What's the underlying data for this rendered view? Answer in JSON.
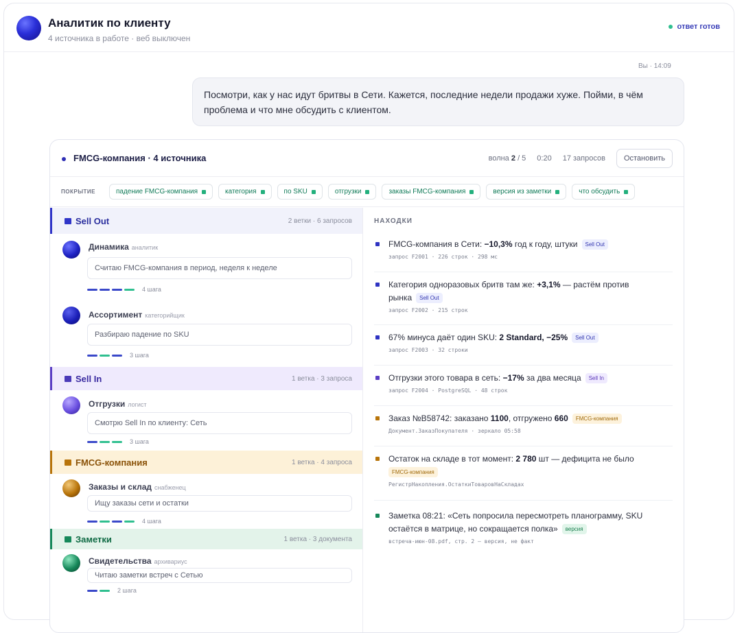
{
  "header": {
    "title": "Аналитик по клиенту",
    "subtitle": "4 источника в работе · веб выключен",
    "status": "ответ готов"
  },
  "message": {
    "meta": "Вы · 14:09",
    "text": "Посмотри, как у нас идут бритвы в Сети. Кажется, последние недели продажи хуже. Пойми, в чём проблема и что мне обсудить с клиентом."
  },
  "panel": {
    "title": "FMCG-компания · 4 источника",
    "wave_label": "волна",
    "wave_current": "2",
    "wave_total": "/ 5",
    "time": "0:20",
    "queries": "17 запросов",
    "stop_label": "Остановить"
  },
  "coverage": {
    "label": "ПОКРЫТИЕ",
    "chips": [
      "падение FMCG-компания",
      "категория",
      "по SKU",
      "отгрузки",
      "заказы FMCG-компания",
      "версия из заметки",
      "что обсудить"
    ]
  },
  "groups": [
    {
      "title": "Sell Out",
      "meta": "2 ветки · 6 запросов",
      "color": "#3035c8",
      "bg": "#f1f2fb"
    },
    {
      "title": "Sell In",
      "meta": "1 ветка · 3 запроса",
      "color": "#5b3fc4",
      "bg": "#efeafd"
    },
    {
      "title": "FMCG-компания",
      "meta": "1 ветка · 4 запроса",
      "color": "#b8740a",
      "bg": "#fdf1d8"
    },
    {
      "title": "Заметки",
      "meta": "1 ветка · 3 документа",
      "color": "#16885a",
      "bg": "#e3f3ea"
    }
  ],
  "agents": [
    {
      "name": "Динамика",
      "role": "аналитик",
      "task": "Считаю FMCG-компания в период, неделя к неделе",
      "steps": "4 шага"
    },
    {
      "name": "Ассортимент",
      "role": "категорийщик",
      "task": "Разбираю падение по SKU",
      "steps": "3 шага"
    },
    {
      "name": "Отгрузки",
      "role": "логист",
      "task": "Смотрю Sell In по клиенту: Сеть",
      "steps": "3 шага"
    },
    {
      "name": "Заказы и склад",
      "role": "снабженец",
      "task": "Ищу заказы сети и остатки",
      "steps": "4 шага"
    },
    {
      "name": "Свидетельства",
      "role": "архивариус",
      "task": "Читаю заметки встреч с Сетью",
      "steps": "2 шага"
    }
  ],
  "findings_header": "НАХОДКИ",
  "findings": [
    {
      "pre": "FMCG-компания в Сети: ",
      "bold": "−10,3%",
      "post": " год к году, штуки",
      "tag": "Sell Out",
      "sub": "запрос F2001 · 226 строк · 298 мс"
    },
    {
      "pre": "Категория одноразовых бритв там же: ",
      "bold": "+3,1%",
      "post": " — растём против рынка",
      "tag": "Sell Out",
      "sub": "запрос F2002 · 215 строк"
    },
    {
      "pre": "67% минуса даёт один SKU: ",
      "bold": "2 Standard, −25%",
      "post": "",
      "tag": "Sell Out",
      "sub": "запрос F2003 · 32 строки"
    },
    {
      "pre": "Отгрузки этого товара в сеть: ",
      "bold": "−17%",
      "post": " за два месяца",
      "tag": "Sell In",
      "sub": "запрос F2004 · PostgreSQL · 48 строк"
    },
    {
      "pre": "Заказ №В58742: заказано ",
      "bold": "1100",
      "mid": ", отгружено ",
      "bold2": "660",
      "post": "",
      "tag": "FMCG-компания",
      "sub": "Документ.ЗаказПокупателя · зеркало 05:58"
    },
    {
      "pre": "Остаток на складе в тот момент: ",
      "bold": "2 780",
      "post": " шт — дефицита не было",
      "tag": "FMCG-компания",
      "sub": "РегистрНакопления.ОстаткиТоваровНаСкладах"
    },
    {
      "pre": "Заметка 08:21: «Сеть попросила пересмотреть планограмму, SKU остаётся в матрице, но сокращается полка»",
      "bold": "",
      "post": "",
      "tag": "версия",
      "sub": "встреча-июн-08.pdf, стр. 2 — версия, не факт"
    }
  ]
}
